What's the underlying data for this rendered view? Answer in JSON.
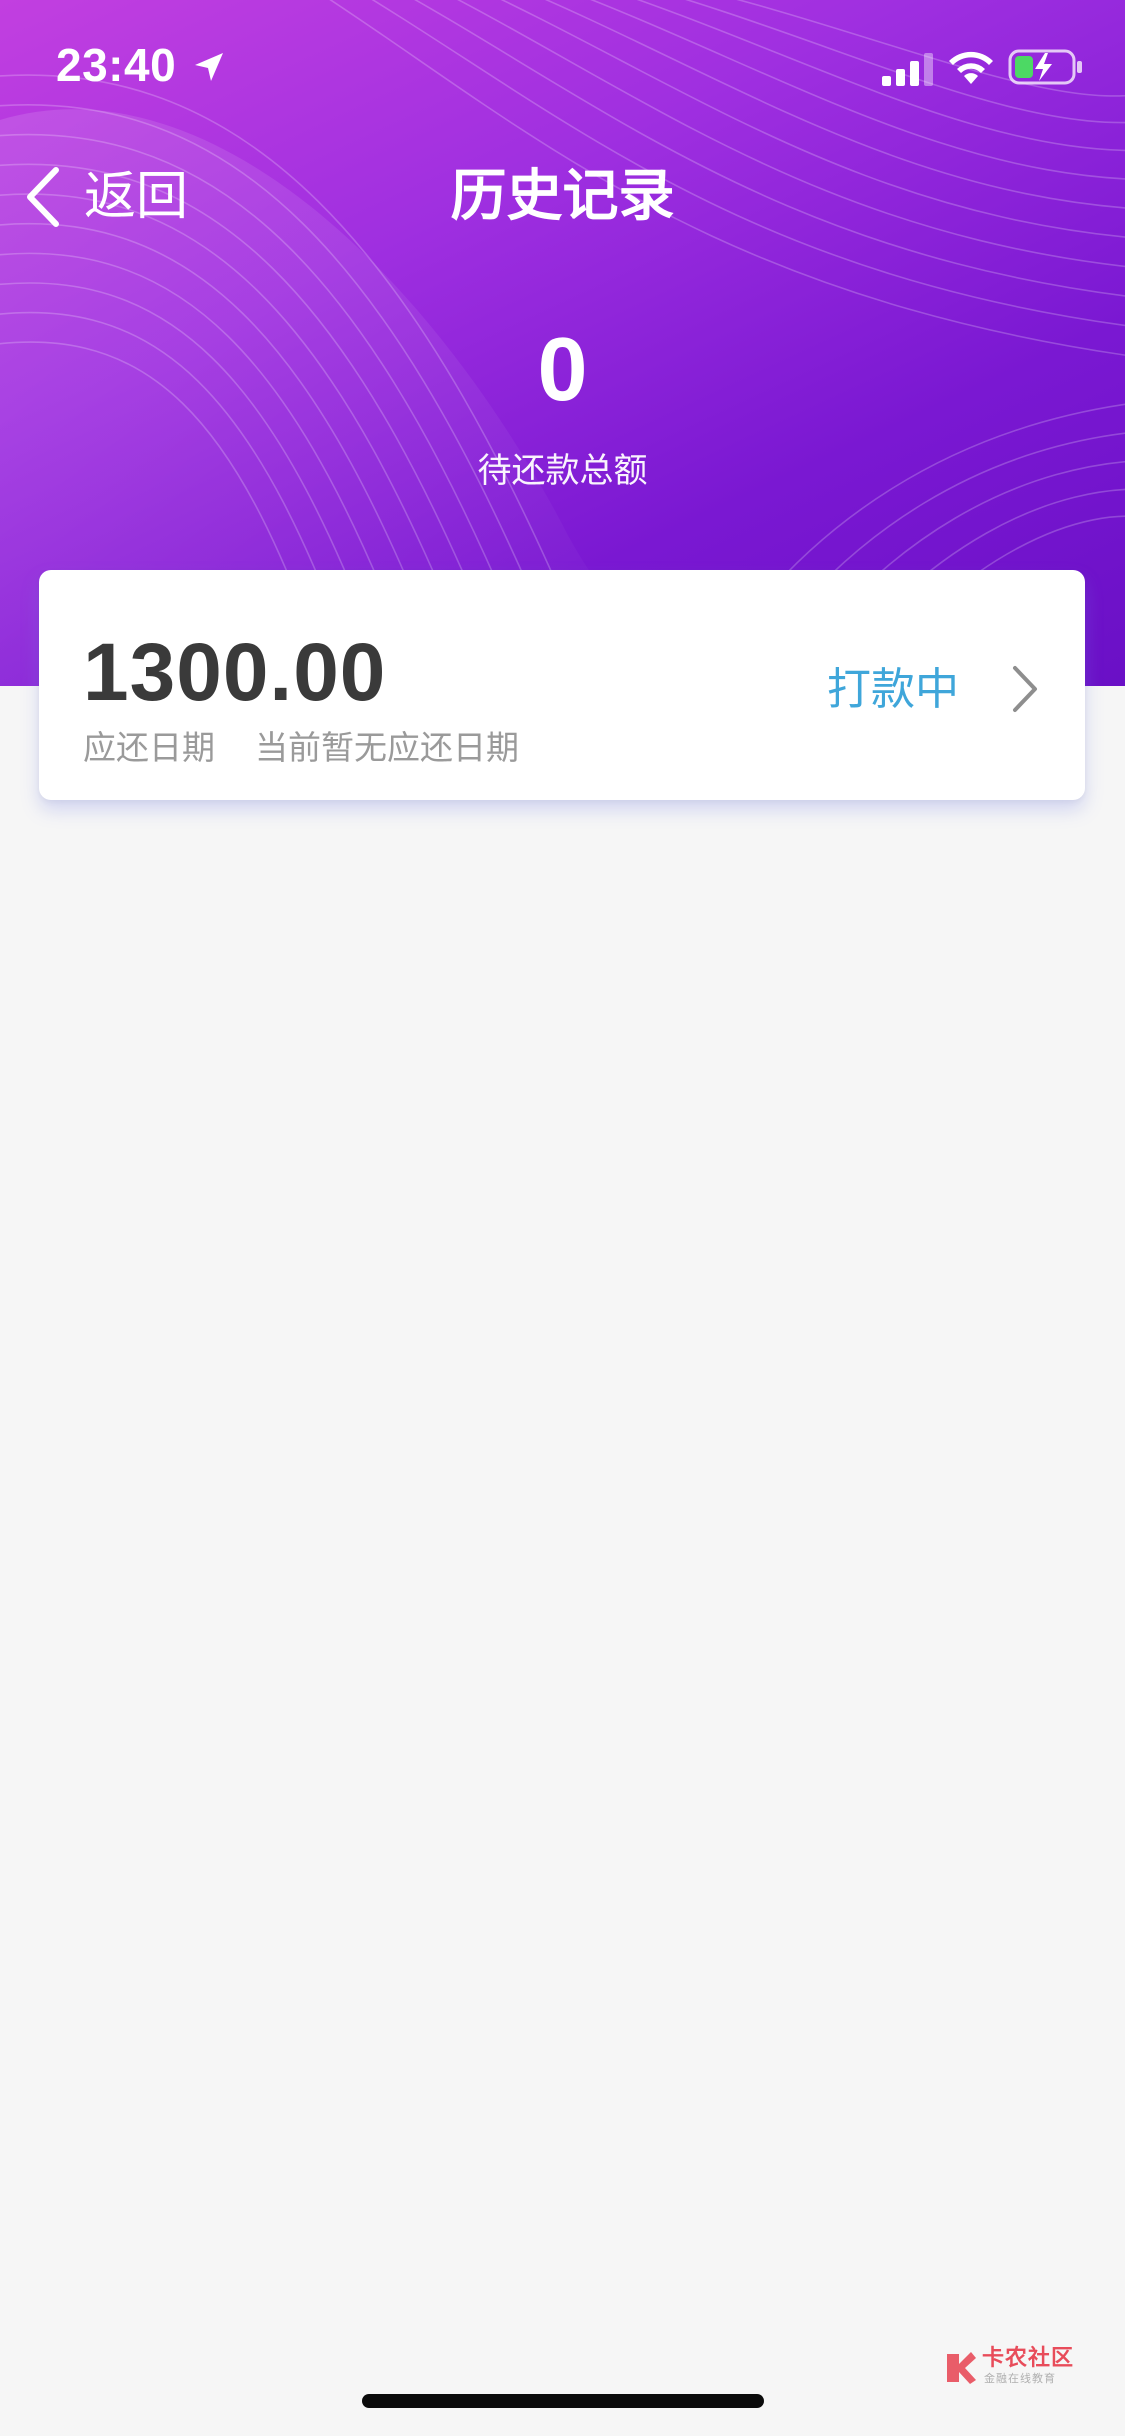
{
  "status_bar": {
    "time": "23:40"
  },
  "nav": {
    "back_label": "返回",
    "title": "历史记录"
  },
  "summary": {
    "total_amount": "0",
    "total_label": "待还款总额"
  },
  "records": [
    {
      "amount": "1300.00",
      "due_label": "应还日期",
      "due_value": "当前暂无应还日期",
      "status": "打款中"
    }
  ],
  "colors": {
    "header_gradient_start": "#c23fe0",
    "header_gradient_end": "#6a10c6",
    "status_text": "#3fa6da",
    "amount_text": "#3a3a3a",
    "secondary_text": "#9a9a9a",
    "page_background": "#f6f6f6",
    "battery_fill": "#4cd964"
  },
  "icons": {
    "location": "location-arrow-icon",
    "signal": "cellular-signal-icon",
    "wifi": "wifi-icon",
    "battery": "battery-charging-icon",
    "back": "chevron-left-icon",
    "detail": "chevron-right-icon"
  },
  "watermark": {
    "title": "卡农社区",
    "subtitle": "金融在线教育"
  }
}
